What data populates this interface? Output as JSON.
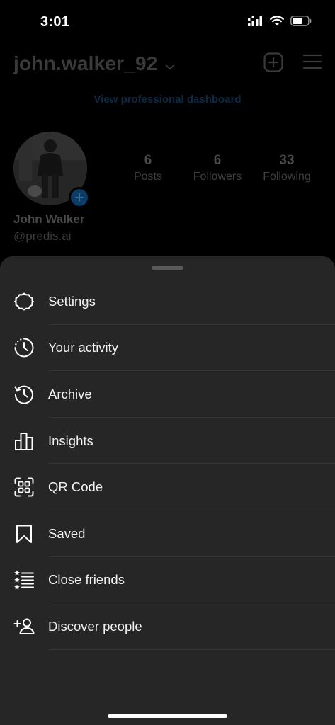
{
  "status_bar": {
    "time": "3:01"
  },
  "profile": {
    "username": "john.walker_92",
    "professional_dashboard_label": "View professional dashboard",
    "display_name": "John Walker",
    "handle": "@predis.ai",
    "stats": [
      {
        "value": "6",
        "label": "Posts"
      },
      {
        "value": "6",
        "label": "Followers"
      },
      {
        "value": "33",
        "label": "Following"
      }
    ]
  },
  "menu": {
    "items": [
      {
        "label": "Settings",
        "icon": "settings-gear-icon"
      },
      {
        "label": "Your activity",
        "icon": "activity-icon"
      },
      {
        "label": "Archive",
        "icon": "archive-history-icon"
      },
      {
        "label": "Insights",
        "icon": "bar-chart-icon"
      },
      {
        "label": "QR Code",
        "icon": "qr-code-icon"
      },
      {
        "label": "Saved",
        "icon": "bookmark-icon"
      },
      {
        "label": "Close friends",
        "icon": "star-list-icon"
      },
      {
        "label": "Discover people",
        "icon": "add-person-icon"
      }
    ]
  },
  "colors": {
    "background": "#000000",
    "sheet": "#262626",
    "accent_blue": "#0d3c66"
  }
}
